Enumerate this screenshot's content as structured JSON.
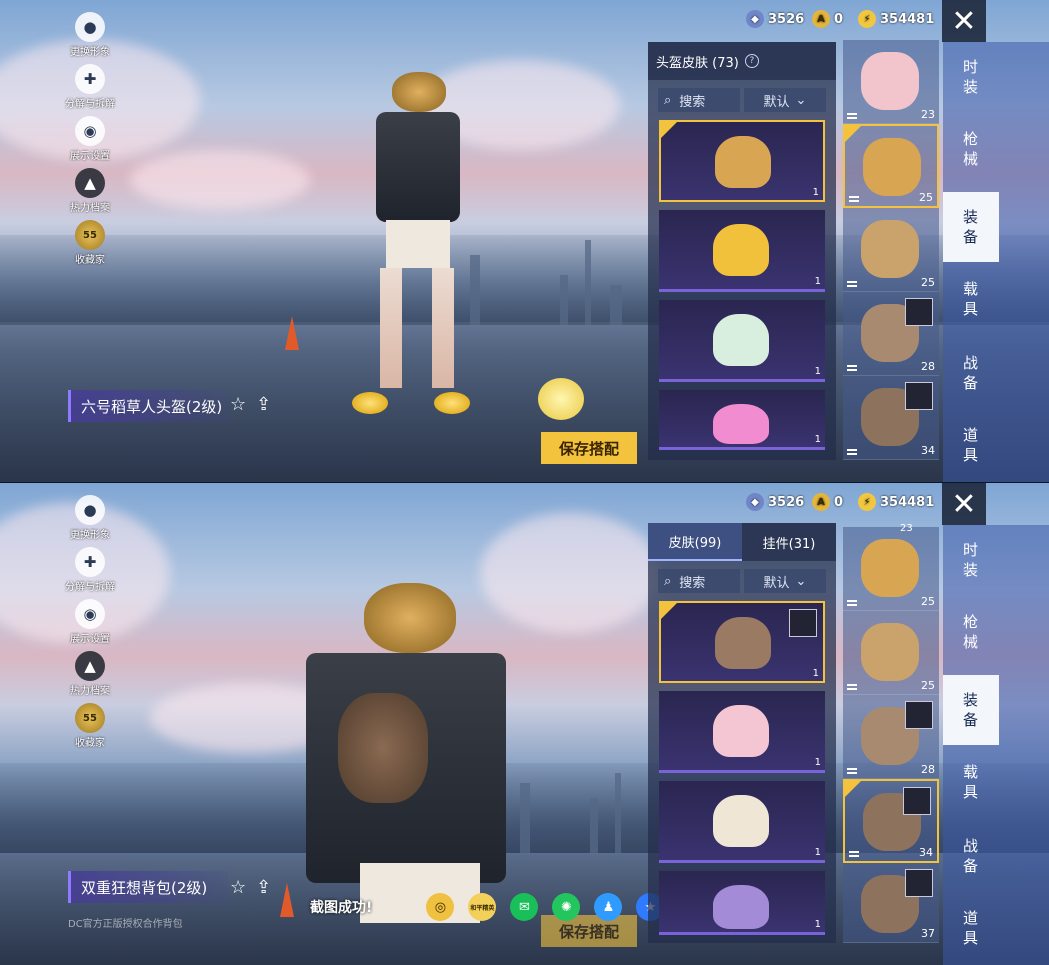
{
  "top": {
    "left_menu": [
      {
        "label": "更换形象",
        "icon": "avatar-icon"
      },
      {
        "label": "分解与拆解",
        "icon": "puzzle-icon"
      },
      {
        "label": "展示设置",
        "icon": "eye-icon"
      },
      {
        "label": "热力档案",
        "icon": "flame-icon"
      },
      {
        "label": "收藏家",
        "icon": "collector-badge-icon",
        "badge": "55"
      }
    ],
    "currency": [
      {
        "value": "3526",
        "icon": "uc-coin-icon",
        "color": "#6f86c9"
      },
      {
        "value": "0",
        "icon": "ag-coin-icon",
        "color": "#e3b53a"
      },
      {
        "value": "354481",
        "icon": "bp-coin-icon",
        "color": "#f1c740"
      }
    ],
    "item_name": "六号稻草人头盔(2级)",
    "save_label": "保存搭配",
    "panel_title": "头盔皮肤 (73)",
    "search_label": "搜索",
    "sort_label": "默认",
    "items": [
      {
        "count": "1",
        "selected": true,
        "color": "#d8a653"
      },
      {
        "count": "1",
        "selected": false,
        "color": "#f2c13c"
      },
      {
        "count": "1",
        "selected": false,
        "color": "#d8efe0"
      },
      {
        "count": "1",
        "selected": false,
        "color": "#f08ccf"
      }
    ],
    "slots": [
      {
        "count": "23",
        "selected": false,
        "color": "#f2c4cc"
      },
      {
        "count": "25",
        "selected": true,
        "color": "#d8a653"
      },
      {
        "count": "25",
        "selected": false,
        "color": "#caa36c"
      },
      {
        "count": "28",
        "selected": false,
        "color": "#a88a70"
      },
      {
        "count": "34",
        "selected": false,
        "color": "#8d735e"
      }
    ],
    "categories": [
      "时装",
      "枪械",
      "装备",
      "载具",
      "战备",
      "道具"
    ],
    "active_category": 2
  },
  "bottom": {
    "left_menu": [
      {
        "label": "更换形象",
        "icon": "avatar-icon"
      },
      {
        "label": "分解与拆解",
        "icon": "puzzle-icon"
      },
      {
        "label": "展示设置",
        "icon": "eye-icon"
      },
      {
        "label": "热力档案",
        "icon": "flame-icon"
      },
      {
        "label": "收藏家",
        "icon": "collector-badge-icon",
        "badge": "55"
      }
    ],
    "currency": [
      {
        "value": "3526"
      },
      {
        "value": "0"
      },
      {
        "value": "354481"
      }
    ],
    "item_name": "双重狂想背包(2级)",
    "watermark": "DC官方正版授权合作背包",
    "tabs": [
      {
        "label": "皮肤(99)",
        "active": true
      },
      {
        "label": "挂件(31)",
        "active": false
      }
    ],
    "search_label": "搜索",
    "sort_label": "默认",
    "items": [
      {
        "count": "1",
        "selected": true,
        "color": "#9a7a63"
      },
      {
        "count": "1",
        "selected": false,
        "color": "#f4c6d4"
      },
      {
        "count": "1",
        "selected": false,
        "color": "#f0e6d6"
      },
      {
        "count": "1",
        "selected": false,
        "color": "#a48bd8"
      }
    ],
    "slots": [
      {
        "count": "23",
        "selected": false,
        "color": "#f2c4cc"
      },
      {
        "count": "25",
        "selected": false,
        "color": "#d8a653"
      },
      {
        "count": "25",
        "selected": false,
        "color": "#caa36c"
      },
      {
        "count": "28",
        "selected": false,
        "color": "#a88a70"
      },
      {
        "count": "34",
        "selected": true,
        "color": "#8d735e"
      },
      {
        "count": "37",
        "selected": false,
        "color": "#8d735e"
      }
    ],
    "categories": [
      "时装",
      "枪械",
      "装备",
      "载具",
      "战备",
      "道具"
    ],
    "active_category": 2,
    "toast": "截图成功!",
    "share_icons": [
      {
        "icon": "camera-share-icon",
        "color": "#f0c040"
      },
      {
        "icon": "game-logo-icon",
        "color": "#f3d05a",
        "text": "和平精英"
      },
      {
        "icon": "wechat-icon",
        "color": "#19c05a"
      },
      {
        "icon": "moments-icon",
        "color": "#22c55e"
      },
      {
        "icon": "qq-icon",
        "color": "#2f9bff"
      },
      {
        "icon": "qzone-icon",
        "color": "#2f7bff"
      }
    ],
    "save_label": "保存搭配"
  }
}
